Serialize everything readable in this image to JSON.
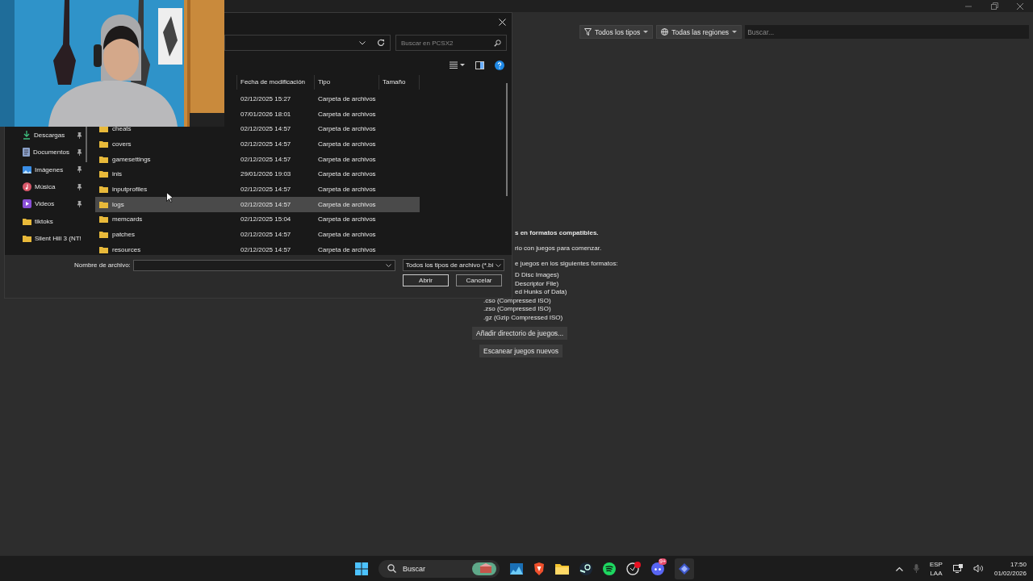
{
  "background_app": {
    "toolbar": {
      "type_filter": "Todos los tipos",
      "region_filter": "Todas las regiones",
      "search": {
        "placeholder": "Buscar..."
      }
    },
    "empty_state": {
      "heading": "s en formatos compatibles.",
      "hint": "rio con juegos para comenzar.",
      "formats_intro": "e juegos en los siguientes formatos:",
      "formats": [
        "D Disc Images)",
        "Descriptor File)",
        "ed Hunks of Data)",
        ".cso (Compressed ISO)",
        ".zso (Compressed ISO)",
        ".gz (Gzip Compressed ISO)"
      ]
    },
    "buttons": [
      "Añadir directorio de juegos...",
      "Escanear juegos nuevos"
    ]
  },
  "file_dialog": {
    "search": {
      "placeholder": "Buscar en PCSX2"
    },
    "columns": [
      "Fecha de modificación",
      "Tipo",
      "Tamaño"
    ],
    "nav_items": [
      {
        "label": "Descargas",
        "kind": "downloads",
        "pinned": true
      },
      {
        "label": "Documentos",
        "kind": "documents",
        "pinned": true
      },
      {
        "label": "Imágenes",
        "kind": "pictures",
        "pinned": true
      },
      {
        "label": "Música",
        "kind": "music",
        "pinned": true
      },
      {
        "label": "Videos",
        "kind": "videos",
        "pinned": true
      },
      {
        "label": "tiktoks",
        "kind": "folder",
        "pinned": false
      },
      {
        "label": "Silent Hill 3 (NT!",
        "kind": "folder",
        "pinned": false
      }
    ],
    "rows": [
      {
        "date": "02/12/2025 15:27",
        "type": "Carpeta de archivos",
        "selected": false
      },
      {
        "date": "07/01/2026 18:01",
        "type": "Carpeta de archivos",
        "selected": false
      },
      {
        "name": "cheats",
        "date": "02/12/2025 14:57",
        "type": "Carpeta de archivos",
        "selected": false
      },
      {
        "name": "covers",
        "date": "02/12/2025 14:57",
        "type": "Carpeta de archivos",
        "selected": false
      },
      {
        "name": "gamesettings",
        "date": "02/12/2025 14:57",
        "type": "Carpeta de archivos",
        "selected": false
      },
      {
        "name": "inis",
        "date": "29/01/2026 19:03",
        "type": "Carpeta de archivos",
        "selected": false
      },
      {
        "name": "inputprofiles",
        "date": "02/12/2025 14:57",
        "type": "Carpeta de archivos",
        "selected": false
      },
      {
        "name": "logs",
        "date": "02/12/2025 14:57",
        "type": "Carpeta de archivos",
        "selected": true
      },
      {
        "name": "memcards",
        "date": "02/12/2025 15:04",
        "type": "Carpeta de archivos",
        "selected": false
      },
      {
        "name": "patches",
        "date": "02/12/2025 14:57",
        "type": "Carpeta de archivos",
        "selected": false
      },
      {
        "name": "resources",
        "date": "02/12/2025 14:57",
        "type": "Carpeta de archivos",
        "selected": false
      }
    ],
    "filename_label": "Nombre de archivo:",
    "file_type": "Todos los tipos de archivo (*.bi",
    "buttons": [
      "Abrir",
      "Cancelar"
    ]
  },
  "taskbar": {
    "search": "Buscar",
    "discord_badge": "9+",
    "language": "ESP",
    "layout": "LAA",
    "time": "17:50",
    "date": "01/02/2026"
  }
}
